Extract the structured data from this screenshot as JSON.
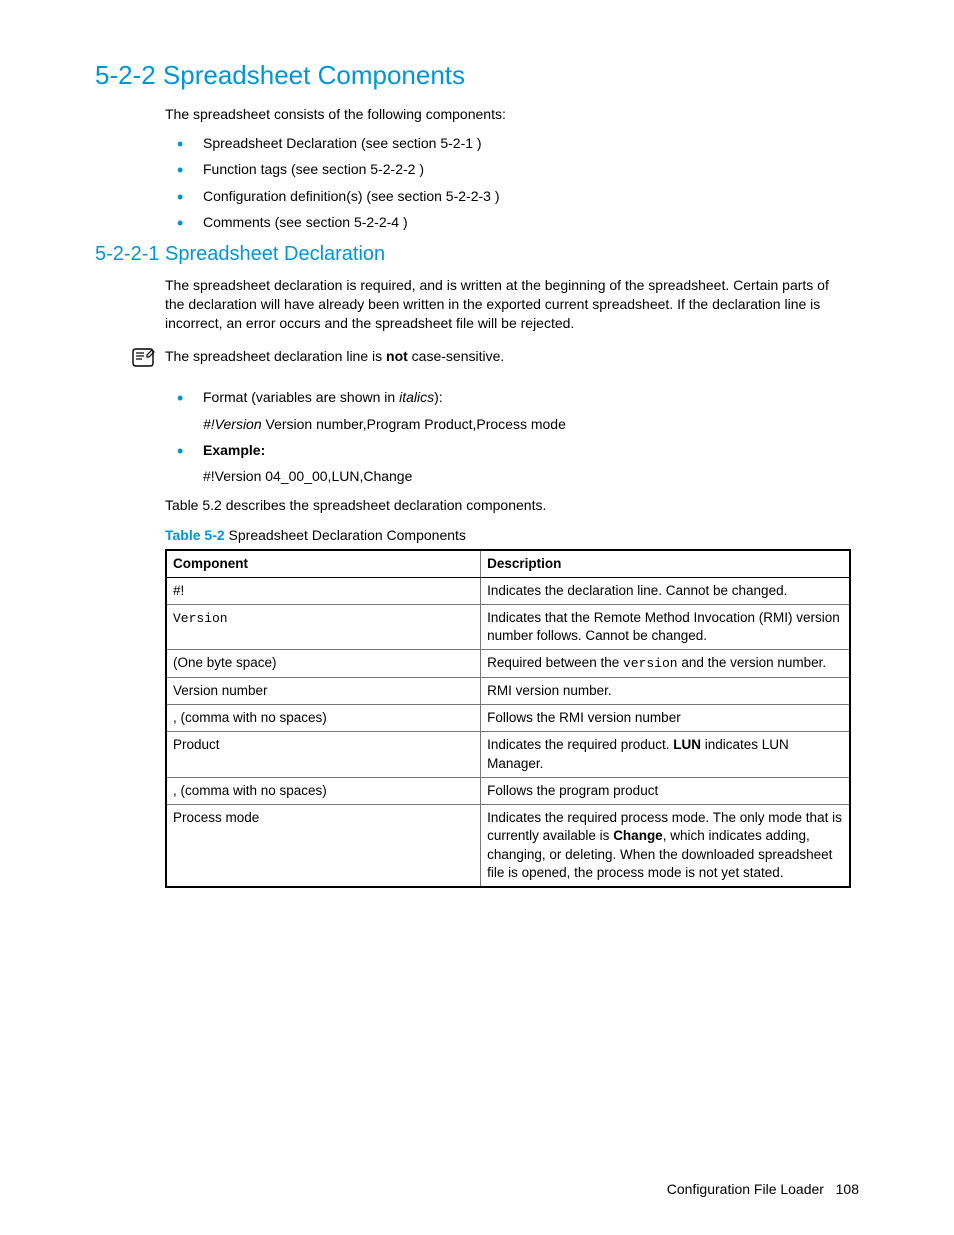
{
  "h1": "5-2-2 Spreadsheet Components",
  "intro": "The spreadsheet consists of the following components:",
  "bullets_main": [
    "Spreadsheet Declaration (see section 5-2-1 )",
    "Function tags (see section 5-2-2-2 )",
    "Configuration definition(s) (see section 5-2-2-3 )",
    "Comments (see section 5-2-2-4 )"
  ],
  "h2": "5-2-2-1 Spreadsheet Declaration",
  "decl_para": "The spreadsheet declaration is required, and is written at the beginning of the spreadsheet. Certain parts of the declaration will have already been written in the exported current spreadsheet. If the declaration line is incorrect, an error occurs and the spreadsheet file will be rejected.",
  "note_pre": "The spreadsheet declaration line is ",
  "note_bold": "not",
  "note_post": " case-sensitive.",
  "format_pre": "Format (variables are shown in ",
  "format_ital": "italics",
  "format_post": "):",
  "format_line_ital": "#!Version",
  "format_line_rest": " Version number,Program Product,Process mode",
  "example_label": "Example:",
  "example_line": "#!Version 04_00_00,LUN,Change",
  "table_intro": "Table 5.2 describes the spreadsheet declaration components.",
  "table_label": "Table 5-2",
  "table_title": "  Spreadsheet Declaration Components",
  "thead": {
    "c1": "Component",
    "c2": "Description"
  },
  "rows": [
    {
      "c1": "#!",
      "c2": "Indicates the declaration line. Cannot be changed."
    },
    {
      "c1_mono": "Version",
      "c2": "Indicates that the Remote Method Invocation (RMI) version number follows. Cannot be changed."
    },
    {
      "c1": "(One byte space)",
      "c2_pre": "Required between the ",
      "c2_mono": "version",
      "c2_post": " and the version number."
    },
    {
      "c1": "Version number",
      "c2": "RMI version number."
    },
    {
      "c1": ", (comma with no spaces)",
      "c2": "Follows the RMI version number"
    },
    {
      "c1": "Product",
      "c2_pre": "Indicates the required product. ",
      "c2_bold": "LUN",
      "c2_post": " indicates LUN Manager."
    },
    {
      "c1": ", (comma with no spaces)",
      "c2": "Follows the program product"
    },
    {
      "c1": "Process mode",
      "c2_pre": "Indicates the required process mode. The only mode that is currently available is ",
      "c2_bold": "Change",
      "c2_post": ", which indicates adding, changing, or deleting. When the downloaded spreadsheet file is opened, the process mode is not yet stated."
    }
  ],
  "footer_text": "Configuration File Loader",
  "footer_page": "108"
}
